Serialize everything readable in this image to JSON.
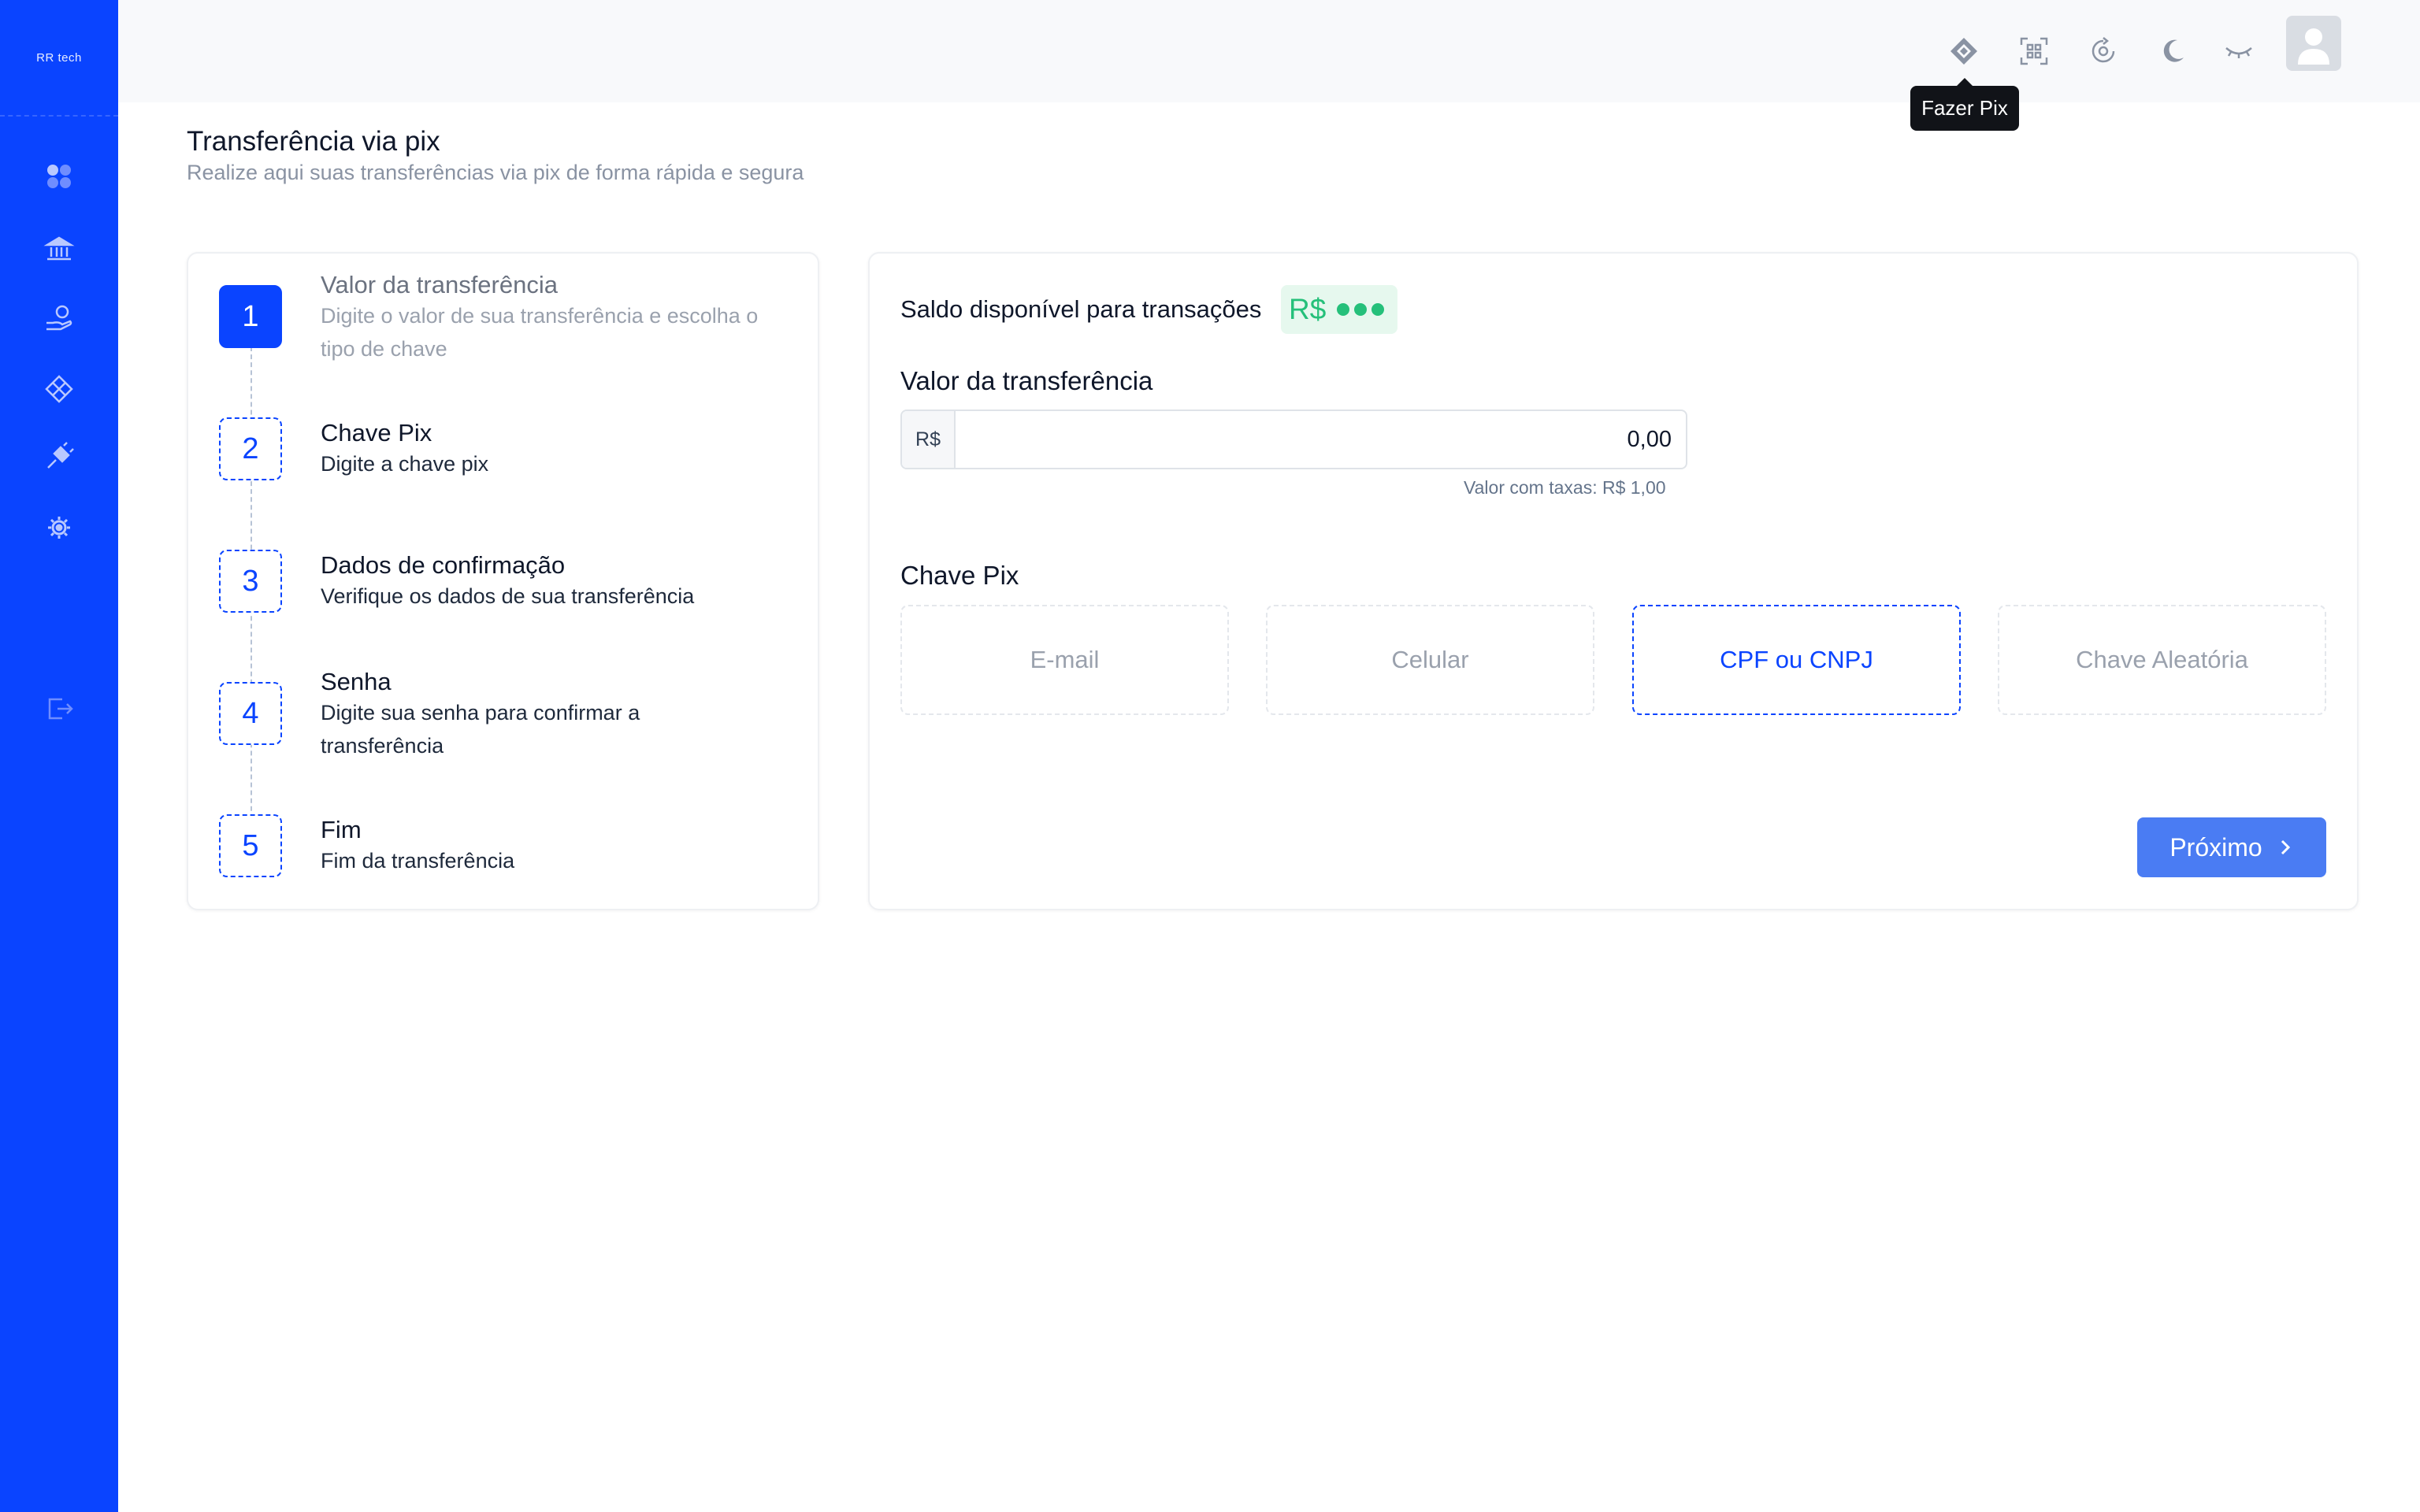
{
  "brand": {
    "logo_text": "RR tech"
  },
  "topbar": {
    "tooltip": "Fazer Pix"
  },
  "page": {
    "title": "Transferência via pix",
    "subtitle": "Realize aqui suas transferências via pix de forma rápida e segura"
  },
  "steps": [
    {
      "number": "1",
      "title": "Valor da transferência",
      "desc": "Digite o valor de sua transferência e escolha o tipo de chave"
    },
    {
      "number": "2",
      "title": "Chave Pix",
      "desc": "Digite a chave pix"
    },
    {
      "number": "3",
      "title": "Dados de confirmação",
      "desc": "Verifique os dados de sua transferência"
    },
    {
      "number": "4",
      "title": "Senha",
      "desc": "Digite sua senha para confirmar a transferência"
    },
    {
      "number": "5",
      "title": "Fim",
      "desc": "Fim da transferência"
    }
  ],
  "form": {
    "balance_label": "Saldo disponível para transações",
    "balance_currency": "R$",
    "amount_label": "Valor da transferência",
    "amount_prefix": "R$",
    "amount_value": "0,00",
    "fee_note": "Valor com taxas: R$ 1,00",
    "key_label": "Chave Pix",
    "key_options": [
      "E-mail",
      "Celular",
      "CPF ou CNPJ",
      "Chave Aleatória"
    ],
    "selected_key": "CPF ou CNPJ",
    "next_label": "Próximo"
  },
  "colors": {
    "primary": "#0a44ff",
    "button": "#4a7cf3",
    "success": "#25c07a"
  }
}
